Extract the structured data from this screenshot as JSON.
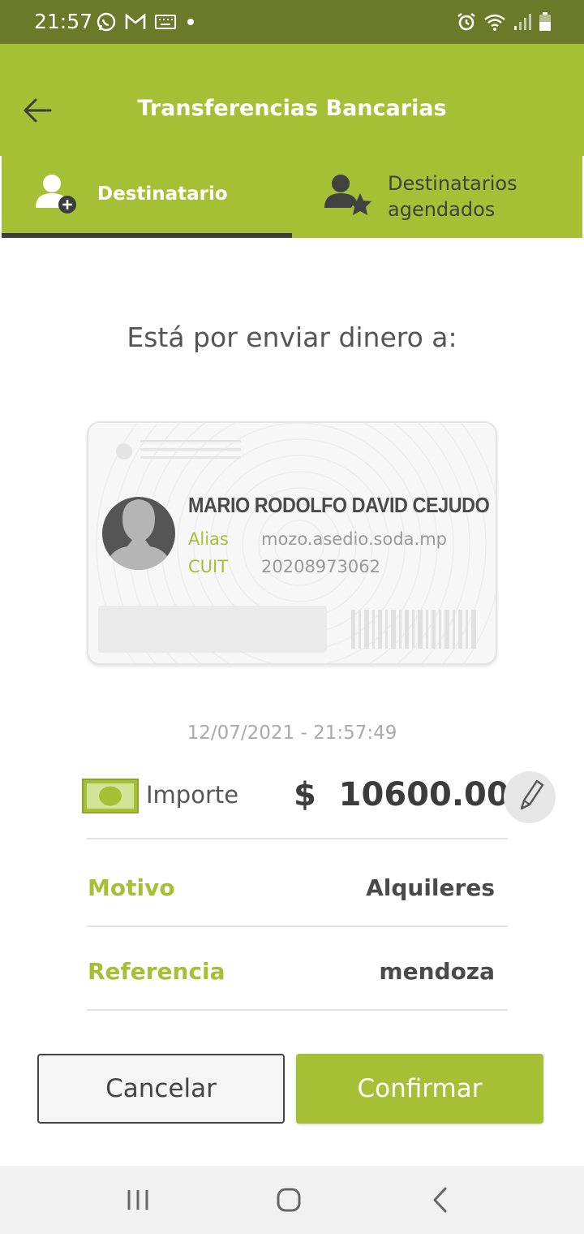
{
  "status_bar": {
    "time": "21:57",
    "icons": [
      "whatsapp-icon",
      "gmail-icon",
      "keyboard-icon",
      "dot-icon",
      "alarm-icon",
      "wifi-icon",
      "signal-icon",
      "battery-icon"
    ]
  },
  "app_bar": {
    "title": "Transferencias Bancarias",
    "back_icon": "arrow-left-icon"
  },
  "tabs": [
    {
      "label": "Destinatario",
      "icon": "add-user-icon",
      "selected": true
    },
    {
      "label_line1": "Destinatarios",
      "label_line2": "agendados",
      "icon": "starred-user-icon",
      "selected": false
    }
  ],
  "main": {
    "heading": "Está por enviar dinero a:",
    "recipient": {
      "name": "MARIO RODOLFO DAVID CEJUDO",
      "alias_label": "Alias",
      "alias_value": "mozo.asedio.soda.mp",
      "cuit_label": "CUIT",
      "cuit_value": "20208973062"
    },
    "datetime": "12/07/2021 - 21:57:49",
    "amount": {
      "label": "Importe",
      "value": "$  10600.00"
    },
    "motivo": {
      "label": "Motivo",
      "value": "Alquileres"
    },
    "referencia": {
      "label": "Referencia",
      "value": "mendoza"
    }
  },
  "actions": {
    "cancel_label": "Cancelar",
    "confirm_label": "Confirmar"
  },
  "colors": {
    "status_bar": "#6a7a28",
    "brand_green": "#a5c035",
    "tab_indicator": "#3c3c3c",
    "text_dark": "#4a4a4a"
  },
  "nav_bar": {
    "icons": [
      "recent-apps-icon",
      "home-icon",
      "back-nav-icon"
    ]
  }
}
